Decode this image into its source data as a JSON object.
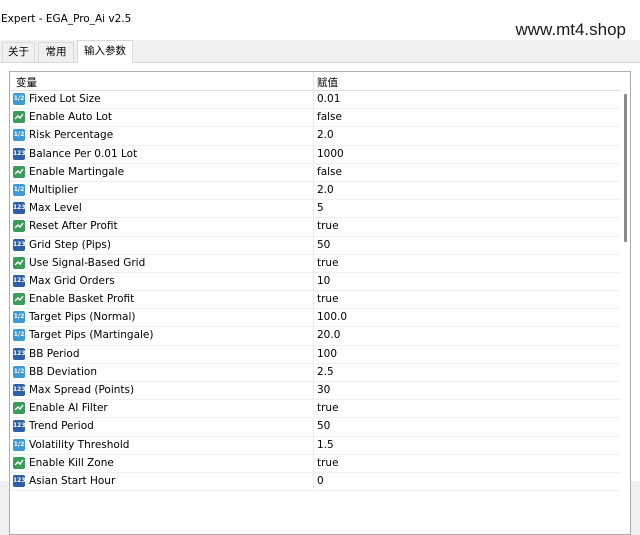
{
  "window": {
    "title": "Expert - EGA_Pro_Ai v2.5"
  },
  "watermark": "www.mt4.shop",
  "tabs": [
    {
      "label": "关于"
    },
    {
      "label": "常用"
    },
    {
      "label": "输入参数"
    }
  ],
  "active_tab": "输入参数",
  "table": {
    "col_variable": "变量",
    "col_value": "赋值",
    "rows": [
      {
        "icon": "double-icon",
        "name": "Fixed Lot Size",
        "value": "0.01"
      },
      {
        "icon": "bool-icon",
        "name": "Enable Auto Lot",
        "value": "false"
      },
      {
        "icon": "double-icon",
        "name": "Risk Percentage",
        "value": "2.0"
      },
      {
        "icon": "int-icon",
        "name": "Balance Per 0.01 Lot",
        "value": "1000"
      },
      {
        "icon": "bool-icon",
        "name": "Enable Martingale",
        "value": "false"
      },
      {
        "icon": "double-icon",
        "name": "Multiplier",
        "value": "2.0"
      },
      {
        "icon": "int-icon",
        "name": "Max Level",
        "value": "5"
      },
      {
        "icon": "bool-icon",
        "name": "Reset After Profit",
        "value": "true"
      },
      {
        "icon": "int-icon",
        "name": "Grid Step (Pips)",
        "value": "50"
      },
      {
        "icon": "bool-icon",
        "name": "Use Signal-Based Grid",
        "value": "true"
      },
      {
        "icon": "int-icon",
        "name": "Max Grid Orders",
        "value": "10"
      },
      {
        "icon": "bool-icon",
        "name": "Enable Basket Profit",
        "value": "true"
      },
      {
        "icon": "double-icon",
        "name": "Target Pips (Normal)",
        "value": "100.0"
      },
      {
        "icon": "double-icon",
        "name": "Target Pips (Martingale)",
        "value": "20.0"
      },
      {
        "icon": "int-icon",
        "name": "BB Period",
        "value": "100"
      },
      {
        "icon": "double-icon",
        "name": "BB Deviation",
        "value": "2.5"
      },
      {
        "icon": "int-icon",
        "name": "Max Spread (Points)",
        "value": "30"
      },
      {
        "icon": "bool-icon",
        "name": "Enable AI Filter",
        "value": "true"
      },
      {
        "icon": "int-icon",
        "name": "Trend Period",
        "value": "50"
      },
      {
        "icon": "double-icon",
        "name": "Volatility Threshold",
        "value": "1.5"
      },
      {
        "icon": "bool-icon",
        "name": "Enable Kill Zone",
        "value": "true"
      },
      {
        "icon": "int-icon",
        "name": "Asian Start Hour",
        "value": "0"
      }
    ]
  },
  "colors": {
    "double_icon": "#3c9ad6",
    "int_icon": "#2c5fa8",
    "bool_icon": "#3b9b58"
  }
}
